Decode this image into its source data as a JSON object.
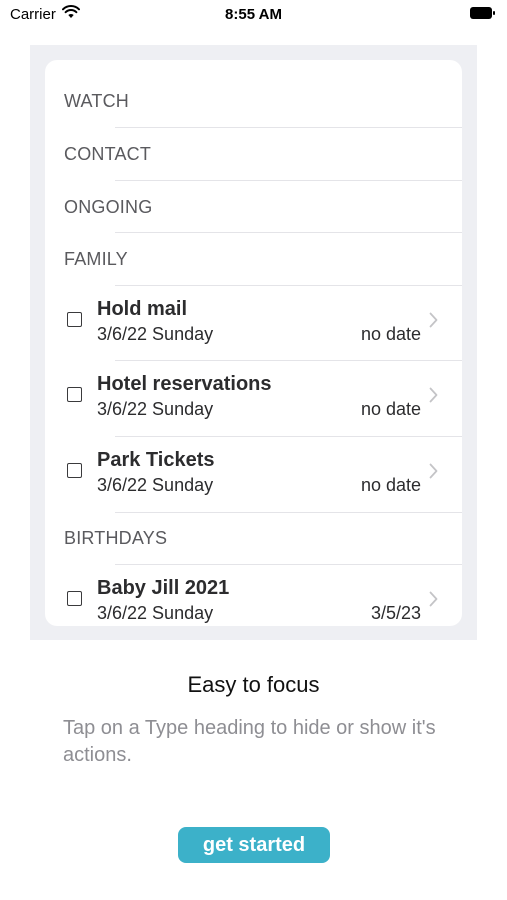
{
  "status_bar": {
    "carrier": "Carrier",
    "time": "8:55 AM"
  },
  "types": [
    {
      "heading": "WATCH",
      "tasks": []
    },
    {
      "heading": "CONTACT",
      "tasks": []
    },
    {
      "heading": "ONGOING",
      "tasks": []
    },
    {
      "heading": "FAMILY",
      "tasks": [
        {
          "title": "Hold mail",
          "date": "3/6/22 Sunday",
          "due": "no date",
          "checked": false
        },
        {
          "title": "Hotel reservations",
          "date": "3/6/22 Sunday",
          "due": "no date",
          "checked": false
        },
        {
          "title": "Park Tickets",
          "date": "3/6/22 Sunday",
          "due": "no date",
          "checked": false
        }
      ]
    },
    {
      "heading": "BIRTHDAYS",
      "tasks": [
        {
          "title": "Baby Jill 2021",
          "date": "3/6/22 Sunday",
          "due": "3/5/23",
          "checked": false
        }
      ]
    }
  ],
  "onboarding": {
    "caption": "Easy to focus",
    "description": "Tap on a Type heading to hide or show it's actions.",
    "button_label": "get started"
  },
  "colors": {
    "accent": "#3cb1c9",
    "preview_bg": "#eeeff3",
    "muted_text": "#8e8e93"
  },
  "icons": {
    "wifi": "wifi-icon",
    "battery": "battery-icon",
    "chevron": "chevron-right-icon",
    "checkbox": "checkbox-icon"
  }
}
